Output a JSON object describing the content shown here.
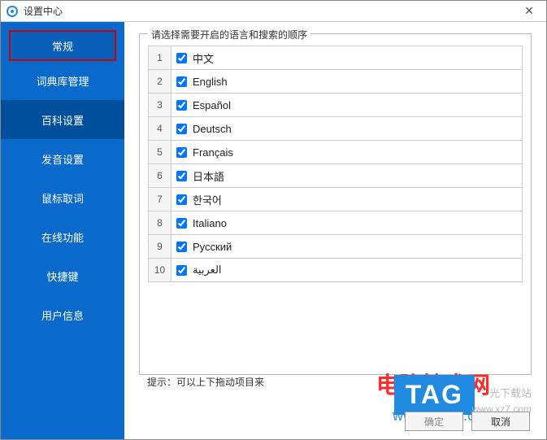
{
  "window": {
    "title": "设置中心"
  },
  "sidebar": {
    "items": [
      {
        "label": "常规"
      },
      {
        "label": "词典库管理"
      },
      {
        "label": "百科设置"
      },
      {
        "label": "发音设置"
      },
      {
        "label": "鼠标取词"
      },
      {
        "label": "在线功能"
      },
      {
        "label": "快捷键"
      },
      {
        "label": "用户信息"
      }
    ]
  },
  "group": {
    "legend": "请选择需要开启的语言和搜索的顺序"
  },
  "languages": [
    {
      "num": "1",
      "label": "中文",
      "checked": true
    },
    {
      "num": "2",
      "label": "English",
      "checked": true
    },
    {
      "num": "3",
      "label": "Español",
      "checked": true
    },
    {
      "num": "4",
      "label": "Deutsch",
      "checked": true
    },
    {
      "num": "5",
      "label": "Français",
      "checked": true
    },
    {
      "num": "6",
      "label": "日本語",
      "checked": true
    },
    {
      "num": "7",
      "label": "한국어",
      "checked": true
    },
    {
      "num": "8",
      "label": "Italiano",
      "checked": true
    },
    {
      "num": "9",
      "label": "Русский",
      "checked": true
    },
    {
      "num": "10",
      "label": "العربية",
      "checked": true
    }
  ],
  "hint": "提示：可以上下拖动项目来",
  "watermarks": {
    "red": "电脑技术网",
    "blue": "www.tagxp.com",
    "tag": "TAG",
    "grey1": "光下载站",
    "grey2": "www.xz7.com"
  },
  "buttons": {
    "ok": "确定",
    "cancel": "取消"
  }
}
